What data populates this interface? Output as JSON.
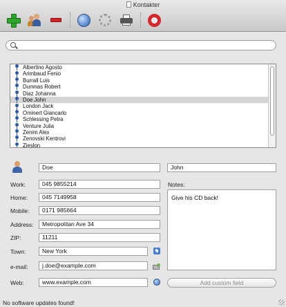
{
  "window": {
    "title": "Kontakter"
  },
  "toolbar": {
    "items": [
      {
        "icon": "plus-icon"
      },
      {
        "icon": "people-icon"
      },
      {
        "icon": "minus-icon"
      },
      {
        "icon": "globe-icon"
      },
      {
        "icon": "gear-icon"
      },
      {
        "icon": "printer-icon"
      },
      {
        "icon": "lifering-icon"
      }
    ]
  },
  "search": {
    "value": "",
    "placeholder": ""
  },
  "contacts": [
    {
      "name": "Albertino Agosto"
    },
    {
      "name": "Arimbaud Fenio"
    },
    {
      "name": "Burrall Luis"
    },
    {
      "name": "Dumnas Robert"
    },
    {
      "name": "Diaz Johanna"
    },
    {
      "name": "Doe John",
      "selected": true
    },
    {
      "name": "London Jack"
    },
    {
      "name": "Ominert Giancarlo"
    },
    {
      "name": "Schlessing Petra"
    },
    {
      "name": "Venture Julia"
    },
    {
      "name": "Zenim Alex"
    },
    {
      "name": "Zenovski Kentrovi"
    },
    {
      "name": "Zieslon"
    }
  ],
  "form": {
    "last_name": "Doe",
    "first_name": "John",
    "work_label": "Work:",
    "work_value": "045 9855214",
    "notes_label": "Notes:",
    "home_label": "Home:",
    "home_value": "045 7149958",
    "mobile_label": "Mobile:",
    "mobile_value": "0171 985664",
    "address_label": "Address:",
    "address_value": "Metropolitan Ave 34",
    "zip_label": "ZIP:",
    "zip_value": "11211",
    "town_label": "Town:",
    "town_value": "New York",
    "email_label": "e-mail:",
    "email_value": "j.doe@example.com",
    "web_label": "Web:",
    "web_value": "www.example.com",
    "notes_value": "Give his CD back!",
    "add_custom_field": "Add custom field"
  },
  "status": {
    "text": "No software updates found!"
  },
  "colors": {
    "accent_add": "#2fa52c",
    "accent_remove": "#d6232a",
    "selection": "#d4d4d4"
  }
}
